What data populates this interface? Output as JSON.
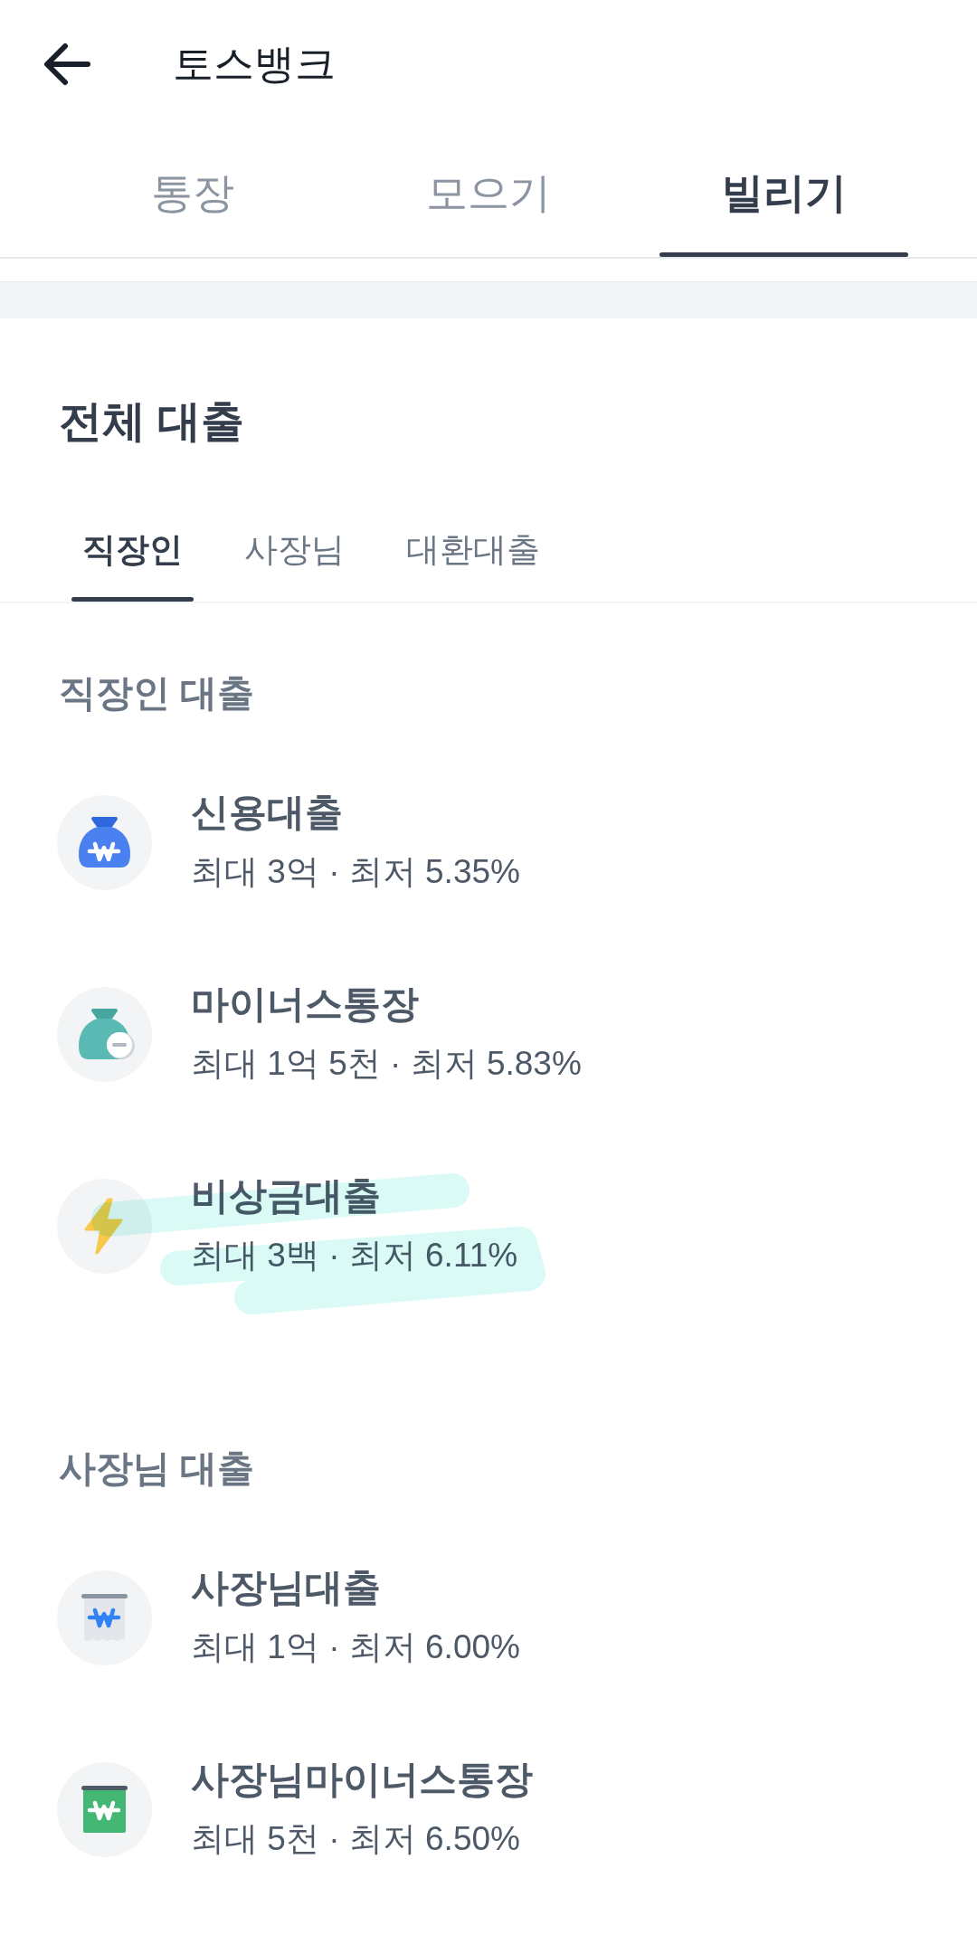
{
  "header": {
    "title": "토스뱅크"
  },
  "tabs": [
    {
      "label": "통장",
      "selected": false
    },
    {
      "label": "모으기",
      "selected": false
    },
    {
      "label": "빌리기",
      "selected": true
    }
  ],
  "section_title": "전체 대출",
  "category_tabs": [
    {
      "label": "직장인",
      "selected": true
    },
    {
      "label": "사장님",
      "selected": false
    },
    {
      "label": "대환대출",
      "selected": false
    }
  ],
  "sections": [
    {
      "heading": "직장인 대출",
      "items": [
        {
          "name": "신용대출",
          "detail": "최대 3억 · 최저 5.35%",
          "highlighted": false
        },
        {
          "name": "마이너스통장",
          "detail": "최대 1억 5천 · 최저 5.83%",
          "highlighted": false
        },
        {
          "name": "비상금대출",
          "detail": "최대 3백 · 최저 6.11%",
          "highlighted": true
        }
      ]
    },
    {
      "heading": "사장님 대출",
      "items": [
        {
          "name": "사장님대출",
          "detail": "최대 1억 · 최저 6.00%",
          "highlighted": false
        },
        {
          "name": "사장님마이너스통장",
          "detail": "최대 5천 · 최저 6.50%",
          "highlighted": false
        }
      ]
    }
  ]
}
